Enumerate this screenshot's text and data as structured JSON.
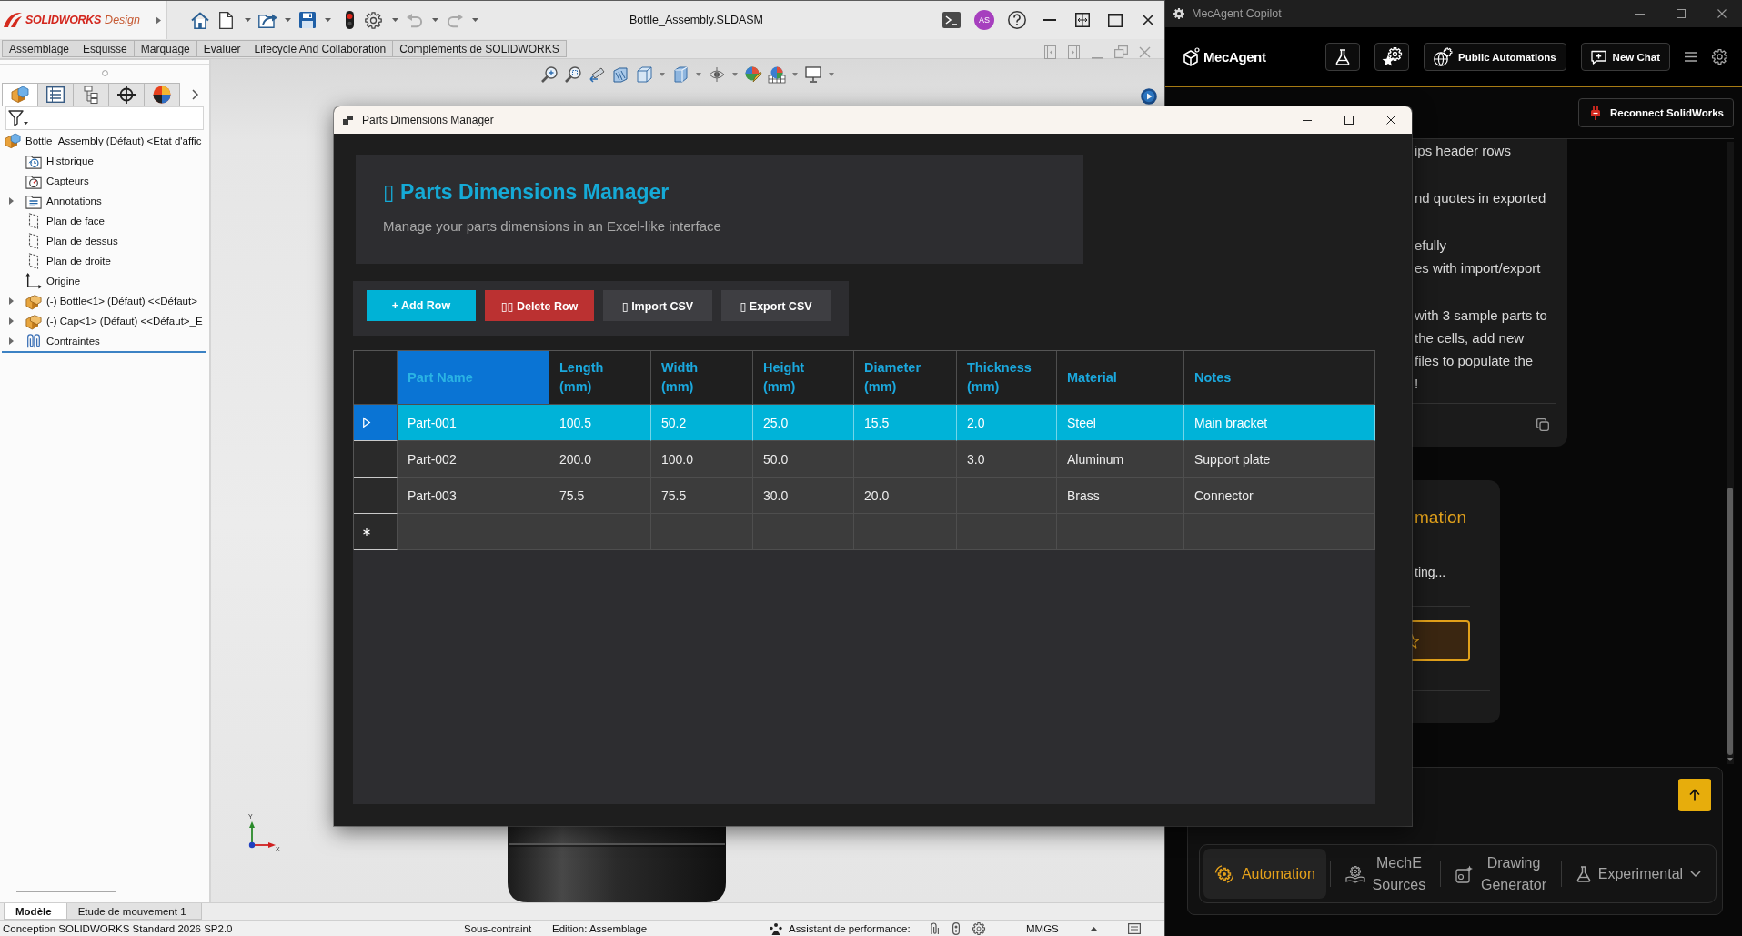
{
  "solidworks": {
    "window": {
      "brand": "SOLIDWORKS",
      "edition": "Design",
      "title": "Bottle_Assembly.SLDASM",
      "user_initials": "AS"
    },
    "ribbon_tabs": [
      "Assemblage",
      "Esquisse",
      "Marquage",
      "Evaluer",
      "Lifecycle And Collaboration",
      "Compléments de SOLIDWORKS"
    ],
    "panel_tabs": [
      {
        "selected": true
      },
      {
        "selected": false
      },
      {
        "selected": false
      },
      {
        "selected": false
      },
      {
        "selected": false
      }
    ],
    "feature_tree": [
      {
        "label": "Bottle_Assembly (Défaut) <Etat d'affic",
        "kind": "assembly",
        "children": [
          {
            "label": "Historique",
            "kind": "history"
          },
          {
            "label": "Capteurs",
            "kind": "sensors"
          },
          {
            "label": "Annotations",
            "kind": "annotations",
            "expanded": false
          },
          {
            "label": "Plan de face",
            "kind": "plane"
          },
          {
            "label": "Plan de dessus",
            "kind": "plane"
          },
          {
            "label": "Plan de droite",
            "kind": "plane"
          },
          {
            "label": "Origine",
            "kind": "origin"
          },
          {
            "label": "(-) Bottle<1> (Défaut) <<Défaut>",
            "kind": "part",
            "expanded": false
          },
          {
            "label": "(-) Cap<1> (Défaut) <<Défaut>_E",
            "kind": "part",
            "expanded": false
          },
          {
            "label": "Contraintes",
            "kind": "mates",
            "expanded": false
          }
        ]
      }
    ],
    "triad": {
      "y_label": "Y",
      "x_label": "X"
    },
    "bottom_tabs": [
      {
        "label": "Modèle",
        "selected": true
      },
      {
        "label": "Etude de mouvement 1",
        "selected": false
      }
    ],
    "status_bar": {
      "product": "Conception SOLIDWORKS Standard 2026 SP2.0",
      "constraint": "Sous-contraint",
      "mode": "Edition: Assemblage",
      "performance": "Assistant de performance:",
      "units": "MMGS"
    }
  },
  "dialog": {
    "title": "Parts Dimensions Manager",
    "heading": "▯ Parts Dimensions Manager",
    "subtitle": "Manage your parts dimensions in an Excel-like interface",
    "buttons": [
      {
        "label": "+ Add Row",
        "kind": "primary"
      },
      {
        "label": "▯▯ Delete Row",
        "kind": "danger"
      },
      {
        "label": "▯ Import CSV",
        "kind": "secondary"
      },
      {
        "label": "▯ Export CSV",
        "kind": "secondary"
      }
    ],
    "table": {
      "columns": [
        {
          "label": "Part Name",
          "selected": true
        },
        {
          "label": "Length",
          "unit": "(mm)",
          "selected": false
        },
        {
          "label": "Width",
          "unit": "(mm)",
          "selected": false
        },
        {
          "label": "Height",
          "unit": "(mm)",
          "selected": false
        },
        {
          "label": "Diameter",
          "unit": "(mm)",
          "selected": false
        },
        {
          "label": "Thickness",
          "unit": "(mm)",
          "selected": false
        },
        {
          "label": "Material",
          "selected": false
        },
        {
          "label": "Notes",
          "selected": false
        }
      ],
      "rows": [
        {
          "selected": true,
          "cells": [
            "Part-001",
            "100.5",
            "50.2",
            "25.0",
            "15.5",
            "2.0",
            "Steel",
            "Main bracket"
          ]
        },
        {
          "selected": false,
          "cells": [
            "Part-002",
            "200.0",
            "100.0",
            "50.0",
            null,
            "3.0",
            "Aluminum",
            "Support plate"
          ]
        },
        {
          "selected": false,
          "cells": [
            "Part-003",
            "75.5",
            "75.5",
            "30.0",
            "20.0",
            null,
            "Brass",
            "Connector"
          ]
        }
      ],
      "new_row": true
    }
  },
  "mecagent": {
    "window": {
      "title": "MecAgent Copilot"
    },
    "brand": "MecAgent",
    "header_buttons": [
      "Public Automations",
      "New Chat"
    ],
    "reconnect_button": "Reconnect SolidWorks",
    "messages": [
      {
        "kind": "text",
        "paragraphs": [
          [
            "ips header rows"
          ],
          [
            "nd quotes in exported"
          ],
          [
            "efully",
            "es with import/export"
          ],
          [
            "with 3 sample parts to",
            "the cells, add new",
            "files to populate the",
            "!"
          ]
        ]
      },
      {
        "kind": "automation",
        "title": "mation",
        "text": "ting..."
      }
    ],
    "mode_tabs": [
      {
        "label": "Automation",
        "kind": "tab",
        "selected": true
      },
      {
        "label": "MechE Sources",
        "kind": "tab",
        "selected": false
      },
      {
        "label": "Drawing Generator",
        "kind": "tab",
        "selected": false
      },
      {
        "label": "Experimental",
        "kind": "dropdown",
        "selected": false
      }
    ]
  }
}
